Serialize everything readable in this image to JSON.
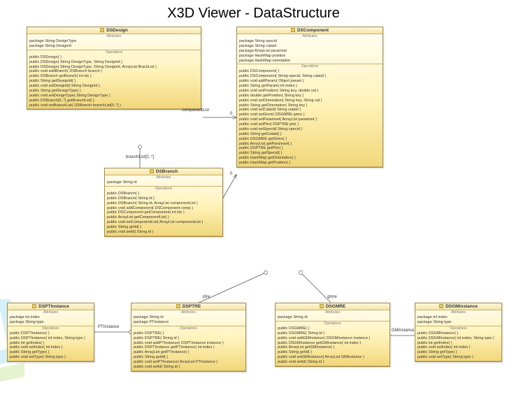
{
  "title": "X3D Viewer - DataStructure",
  "section_labels": {
    "attr": "Attributes",
    "ops": "Operations"
  },
  "edge_labels": {
    "componentList": "componentList",
    "branchList": "branchList[0..*]",
    "ptre": "ptre",
    "gmre": "gmre",
    "pti": "PTInstance",
    "gmi": "GMInstance",
    "zero_a": "0",
    "zero_b": "0"
  },
  "classes": {
    "DSDesign": {
      "name": "DSDesign",
      "attrs": [
        "package String DesignType",
        "package String DesignId"
      ],
      "ops": [
        "public DSDesign( )",
        "public DSDesign( String DesignType, String DesignId )",
        "public DSDesign( String DesignType, String DesignId, ArrayList BrachList )",
        "public void addBranch( DSBranch branch )",
        "public DSBranch getBranch( int idx )",
        "public String getDesignId( )",
        "public void setDesignId( String DesignId )",
        "public String getDesignType( )",
        "public void setDesignType( String DesignType )",
        "public DSBranch[0..*] getBranchList( )",
        "public void setBranchList( DSBranch branchList[0..*] )"
      ]
    },
    "DSBranch": {
      "name": "DSBranch",
      "attrs": [
        "package String id"
      ],
      "ops": [
        "public DSBranch( )",
        "public DSBranch( String id )",
        "public DSBranch( String id, ArrayList componentList )",
        "public void addComponent( DSComponent comp )",
        "public DSComponent getComponent( int idx )",
        "public ArrayList getComponentList( )",
        "public void setComponentList( ArrayList componentList )",
        "public String getId( )",
        "public void setId( String id )"
      ]
    },
    "DSComponent": {
      "name": "DSComponent",
      "attrs": [
        "package String specid",
        "package String cataid",
        "package ArrayList paramset",
        "package HashMap position",
        "package HashMap orientation"
      ],
      "ops": [
        "public DSComponent( )",
        "public DSComponent( String specid, String cataid )",
        "public void addParam( Object param )",
        "public String getParam( int index )",
        "public void setPosition( String key, double val )",
        "public double getPosition( String key )",
        "public void setOrientation( String key, String val )",
        "public String getOrientation( String key )",
        "public void setCataid( String cataid )",
        "public void setGmre( DSGMRE gmre )",
        "public void setParamset( ArrayList paramset )",
        "public void setPtre( DSPTRE ptre )",
        "public void setSpecid( String specid )",
        "public String getCataid( )",
        "public DSGMRE getGmre( )",
        "public ArrayList getParamset( )",
        "public DSPTRE getPtre( )",
        "public String getSpecid( )",
        "public HashMap getOrientation( )",
        "public HashMap getPosition( )"
      ]
    },
    "DSPTInstance": {
      "name": "DSPTInstance",
      "attrs": [
        "package int index",
        "package String type"
      ],
      "ops": [
        "public DSPTInstance( )",
        "public DSPTInstance( int index, String type )",
        "public int getIndex( )",
        "public void setIndex( int index )",
        "public String getType( )",
        "public void setType( String type )"
      ]
    },
    "DSPTRE": {
      "name": "DSPTRE",
      "attrs": [
        "package String id",
        "package PTInstance"
      ],
      "ops": [
        "public DSPTRE( )",
        "public DSPTRE( String id )",
        "public void addPTInstance( DSPTInstance instance )",
        "public DSPTInstance getPTInstance( int index )",
        "public ArrayList getPTInstance( )",
        "public String getId( )",
        "public void setPTInstance( ArrayList PTInstance )",
        "public void setId( String id )"
      ]
    },
    "DSGMRE": {
      "name": "DSGMRE",
      "attrs": [
        "package String id"
      ],
      "ops": [
        "public DSGMRE( )",
        "public DSGMRE( String id )",
        "public void addGMInstance( DSGMInstance instance )",
        "public DSGMInstance getGMInstance( int index )",
        "public ArrayList getGMInstance( )",
        "public String getId( )",
        "public void setGMInstance( ArrayList GMInstance )",
        "public void setId( String id )"
      ]
    },
    "DSGMInstance": {
      "name": "DSGMInstance",
      "attrs": [
        "package int index",
        "package String type"
      ],
      "ops": [
        "public DSGMInstance( )",
        "public DSGMInstance( int index, String type )",
        "public int getIndex( )",
        "public void setIndex( int index )",
        "public String getType( )",
        "public void setType( String type )"
      ]
    }
  }
}
